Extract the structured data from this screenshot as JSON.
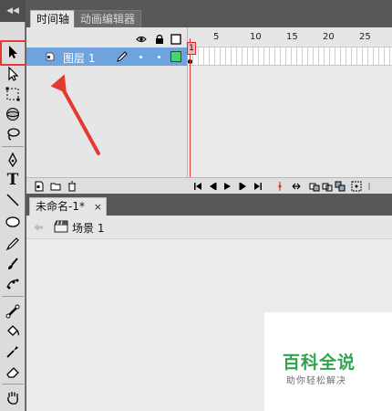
{
  "timeline_panel": {
    "tabs": [
      {
        "label": "时间轴"
      },
      {
        "label": "动画编辑器"
      }
    ],
    "header_icons": [
      "eye-icon",
      "lock-icon",
      "outline-square-icon"
    ],
    "layers": [
      {
        "name": "图层 1"
      }
    ],
    "frame_numbers": [
      "1",
      "5",
      "10",
      "15",
      "20",
      "25"
    ],
    "current_frame": "1"
  },
  "document": {
    "tab_label": "未命名-1*",
    "tab_close": "×",
    "scene_label": "场景 1"
  },
  "toolbar": {
    "collapse_label": "◀◀",
    "text_tool_glyph": "T"
  },
  "watermark": {
    "title": "百科全说",
    "subtitle": "助你轻松解决"
  },
  "colors": {
    "selected_layer": "#6ea3de",
    "playhead": "#e53935",
    "highlight_box": "#e53935",
    "watermark_green": "#2ea44f"
  }
}
